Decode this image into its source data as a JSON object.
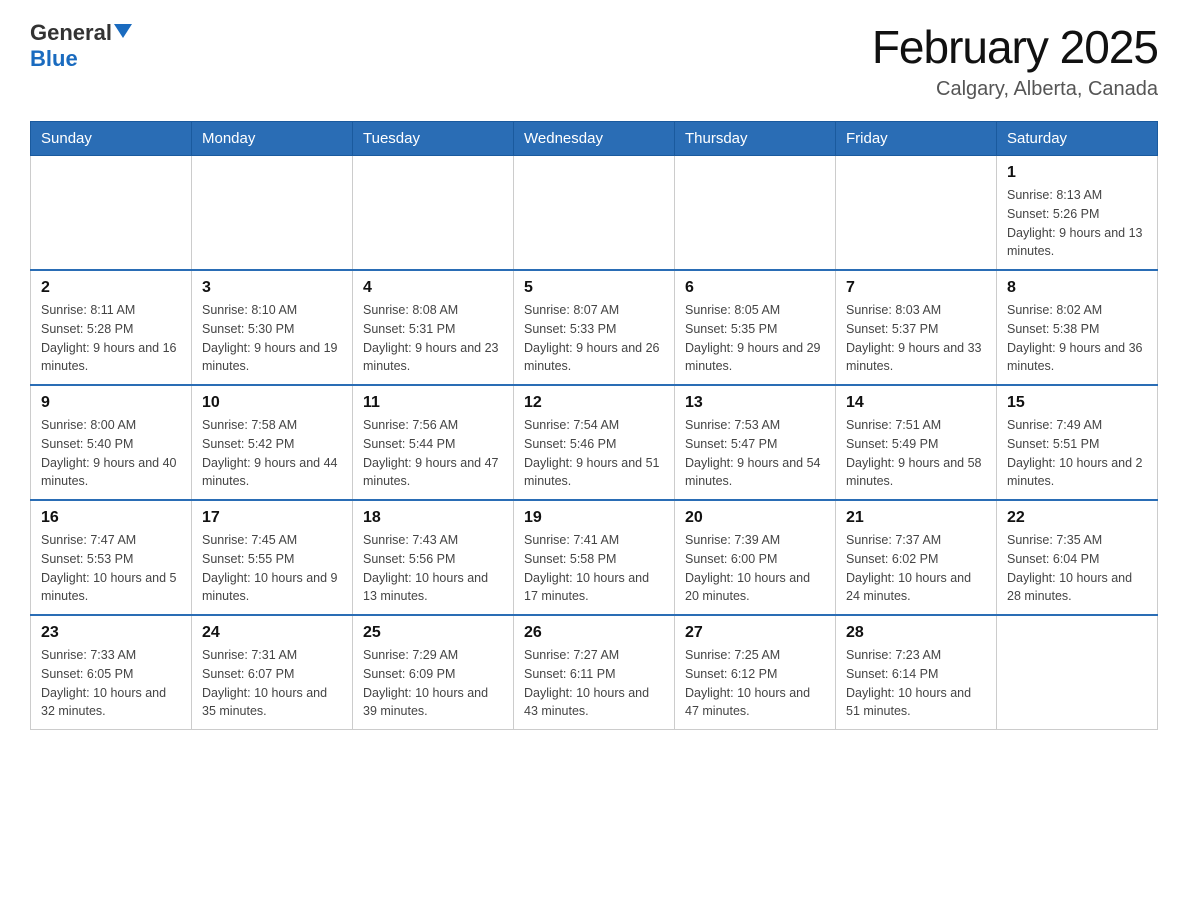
{
  "header": {
    "logo_general": "General",
    "logo_blue": "Blue",
    "month_title": "February 2025",
    "location": "Calgary, Alberta, Canada"
  },
  "days_of_week": [
    "Sunday",
    "Monday",
    "Tuesday",
    "Wednesday",
    "Thursday",
    "Friday",
    "Saturday"
  ],
  "weeks": [
    {
      "days": [
        {
          "number": "",
          "info": ""
        },
        {
          "number": "",
          "info": ""
        },
        {
          "number": "",
          "info": ""
        },
        {
          "number": "",
          "info": ""
        },
        {
          "number": "",
          "info": ""
        },
        {
          "number": "",
          "info": ""
        },
        {
          "number": "1",
          "info": "Sunrise: 8:13 AM\nSunset: 5:26 PM\nDaylight: 9 hours and 13 minutes."
        }
      ]
    },
    {
      "days": [
        {
          "number": "2",
          "info": "Sunrise: 8:11 AM\nSunset: 5:28 PM\nDaylight: 9 hours and 16 minutes."
        },
        {
          "number": "3",
          "info": "Sunrise: 8:10 AM\nSunset: 5:30 PM\nDaylight: 9 hours and 19 minutes."
        },
        {
          "number": "4",
          "info": "Sunrise: 8:08 AM\nSunset: 5:31 PM\nDaylight: 9 hours and 23 minutes."
        },
        {
          "number": "5",
          "info": "Sunrise: 8:07 AM\nSunset: 5:33 PM\nDaylight: 9 hours and 26 minutes."
        },
        {
          "number": "6",
          "info": "Sunrise: 8:05 AM\nSunset: 5:35 PM\nDaylight: 9 hours and 29 minutes."
        },
        {
          "number": "7",
          "info": "Sunrise: 8:03 AM\nSunset: 5:37 PM\nDaylight: 9 hours and 33 minutes."
        },
        {
          "number": "8",
          "info": "Sunrise: 8:02 AM\nSunset: 5:38 PM\nDaylight: 9 hours and 36 minutes."
        }
      ]
    },
    {
      "days": [
        {
          "number": "9",
          "info": "Sunrise: 8:00 AM\nSunset: 5:40 PM\nDaylight: 9 hours and 40 minutes."
        },
        {
          "number": "10",
          "info": "Sunrise: 7:58 AM\nSunset: 5:42 PM\nDaylight: 9 hours and 44 minutes."
        },
        {
          "number": "11",
          "info": "Sunrise: 7:56 AM\nSunset: 5:44 PM\nDaylight: 9 hours and 47 minutes."
        },
        {
          "number": "12",
          "info": "Sunrise: 7:54 AM\nSunset: 5:46 PM\nDaylight: 9 hours and 51 minutes."
        },
        {
          "number": "13",
          "info": "Sunrise: 7:53 AM\nSunset: 5:47 PM\nDaylight: 9 hours and 54 minutes."
        },
        {
          "number": "14",
          "info": "Sunrise: 7:51 AM\nSunset: 5:49 PM\nDaylight: 9 hours and 58 minutes."
        },
        {
          "number": "15",
          "info": "Sunrise: 7:49 AM\nSunset: 5:51 PM\nDaylight: 10 hours and 2 minutes."
        }
      ]
    },
    {
      "days": [
        {
          "number": "16",
          "info": "Sunrise: 7:47 AM\nSunset: 5:53 PM\nDaylight: 10 hours and 5 minutes."
        },
        {
          "number": "17",
          "info": "Sunrise: 7:45 AM\nSunset: 5:55 PM\nDaylight: 10 hours and 9 minutes."
        },
        {
          "number": "18",
          "info": "Sunrise: 7:43 AM\nSunset: 5:56 PM\nDaylight: 10 hours and 13 minutes."
        },
        {
          "number": "19",
          "info": "Sunrise: 7:41 AM\nSunset: 5:58 PM\nDaylight: 10 hours and 17 minutes."
        },
        {
          "number": "20",
          "info": "Sunrise: 7:39 AM\nSunset: 6:00 PM\nDaylight: 10 hours and 20 minutes."
        },
        {
          "number": "21",
          "info": "Sunrise: 7:37 AM\nSunset: 6:02 PM\nDaylight: 10 hours and 24 minutes."
        },
        {
          "number": "22",
          "info": "Sunrise: 7:35 AM\nSunset: 6:04 PM\nDaylight: 10 hours and 28 minutes."
        }
      ]
    },
    {
      "days": [
        {
          "number": "23",
          "info": "Sunrise: 7:33 AM\nSunset: 6:05 PM\nDaylight: 10 hours and 32 minutes."
        },
        {
          "number": "24",
          "info": "Sunrise: 7:31 AM\nSunset: 6:07 PM\nDaylight: 10 hours and 35 minutes."
        },
        {
          "number": "25",
          "info": "Sunrise: 7:29 AM\nSunset: 6:09 PM\nDaylight: 10 hours and 39 minutes."
        },
        {
          "number": "26",
          "info": "Sunrise: 7:27 AM\nSunset: 6:11 PM\nDaylight: 10 hours and 43 minutes."
        },
        {
          "number": "27",
          "info": "Sunrise: 7:25 AM\nSunset: 6:12 PM\nDaylight: 10 hours and 47 minutes."
        },
        {
          "number": "28",
          "info": "Sunrise: 7:23 AM\nSunset: 6:14 PM\nDaylight: 10 hours and 51 minutes."
        },
        {
          "number": "",
          "info": ""
        }
      ]
    }
  ]
}
